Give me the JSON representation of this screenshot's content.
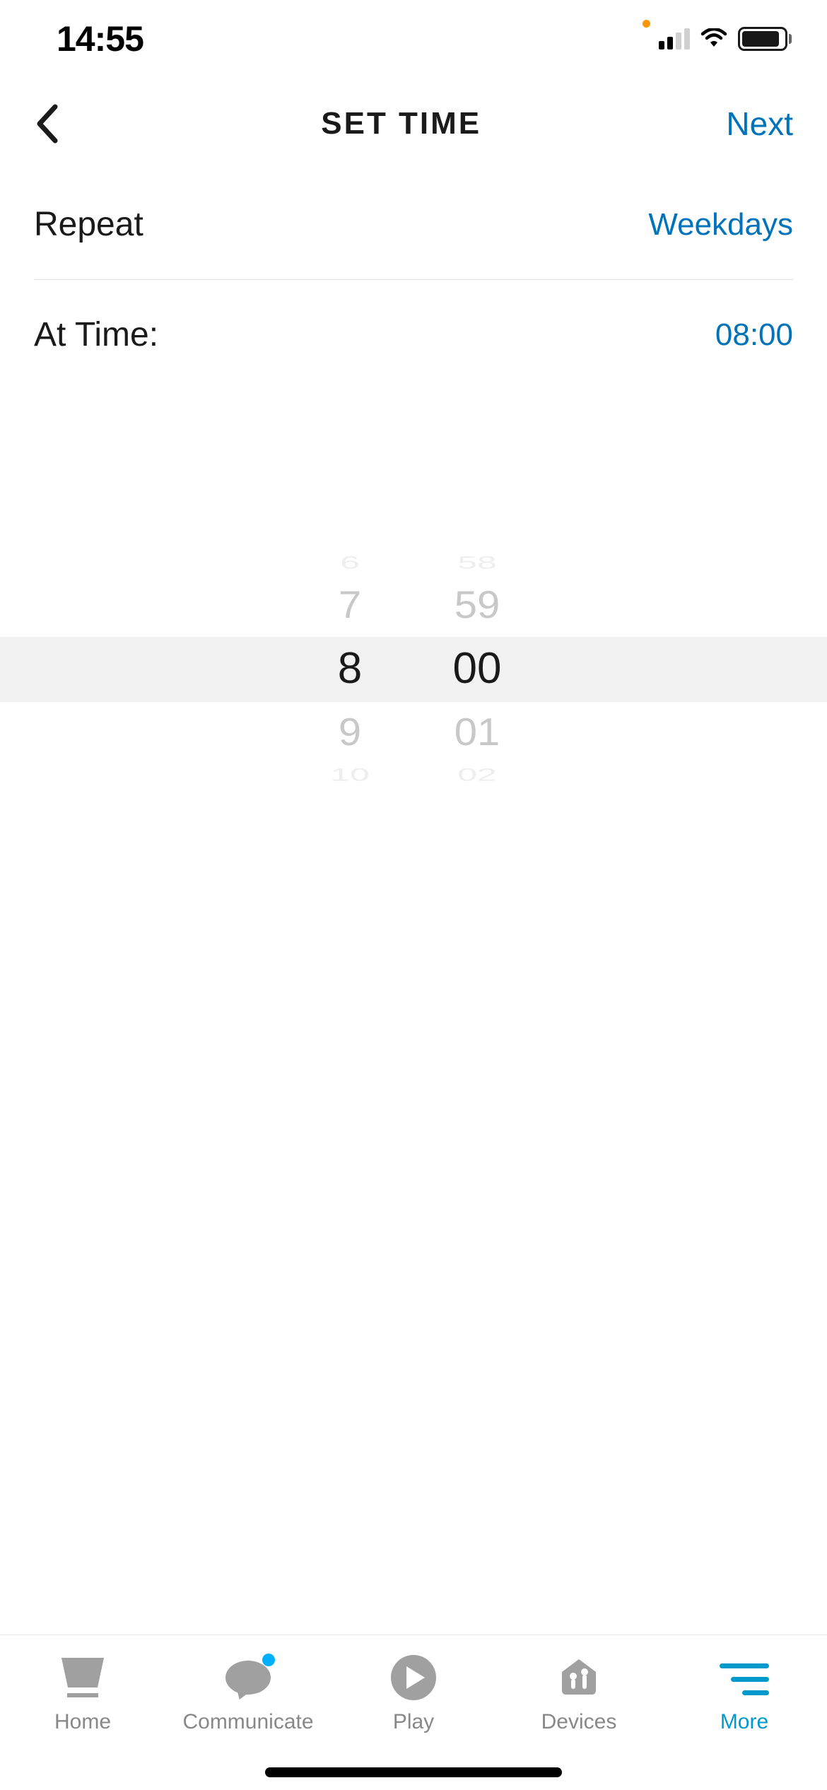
{
  "status": {
    "time": "14:55"
  },
  "nav": {
    "title": "SET TIME",
    "next_label": "Next"
  },
  "repeat": {
    "label": "Repeat",
    "value": "Weekdays"
  },
  "at_time": {
    "label": "At Time:",
    "value": "08:00"
  },
  "picker": {
    "hours": {
      "far_prev": "6",
      "prev": "7",
      "selected": "8",
      "next": "9",
      "far_next": "10"
    },
    "minutes": {
      "far_prev": "58",
      "prev": "59",
      "selected": "00",
      "next": "01",
      "far_next": "02"
    }
  },
  "tabs": {
    "home": "Home",
    "communicate": "Communicate",
    "play": "Play",
    "devices": "Devices",
    "more": "More"
  },
  "colors": {
    "accent": "#0073bb",
    "tab_active": "#0099cc",
    "inactive_gray": "#a0a0a0"
  }
}
